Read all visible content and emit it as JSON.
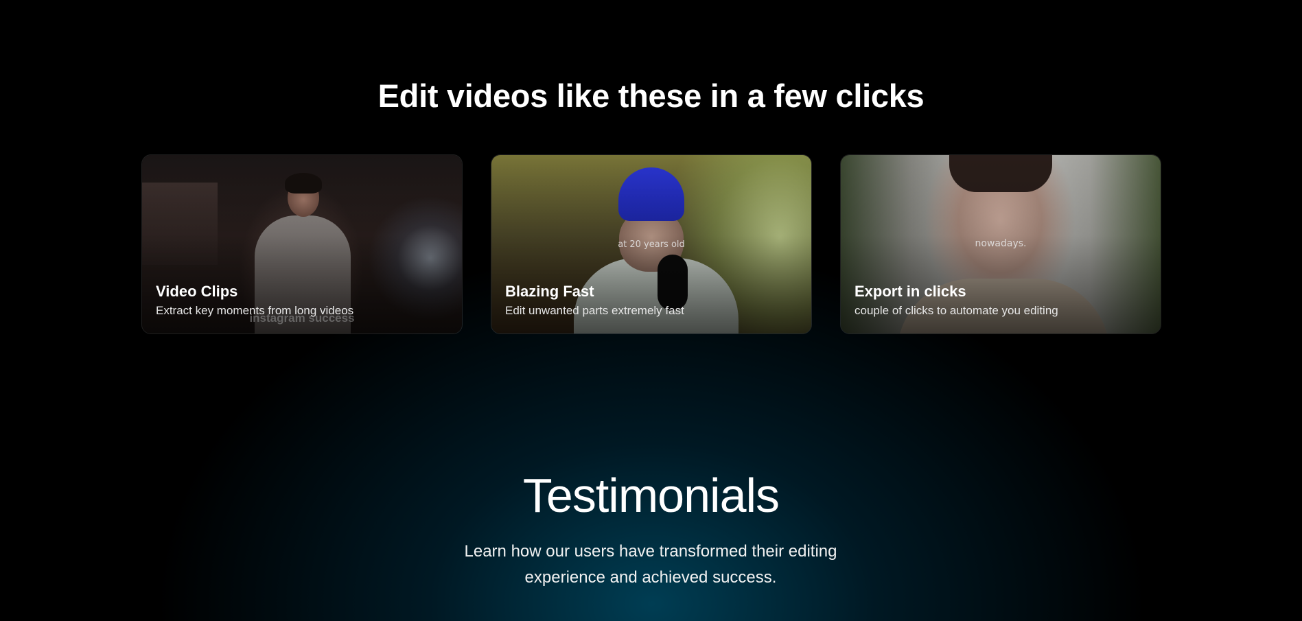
{
  "section": {
    "headline": "Edit videos like these in a few clicks"
  },
  "cards": [
    {
      "title": "Video Clips",
      "description": "Extract key moments from long videos",
      "video_caption": "instagram success"
    },
    {
      "title": "Blazing Fast",
      "description": "Edit unwanted parts extremely fast",
      "video_caption": "at 20 years old"
    },
    {
      "title": "Export in clicks",
      "description": "couple of clicks to automate you editing",
      "video_caption": "nowadays."
    }
  ],
  "testimonials": {
    "title": "Testimonials",
    "subtitle": "Learn how our users have transformed their editing experience and achieved success."
  },
  "colors": {
    "background": "#000000",
    "glow": "#004862",
    "text": "#ffffff"
  }
}
